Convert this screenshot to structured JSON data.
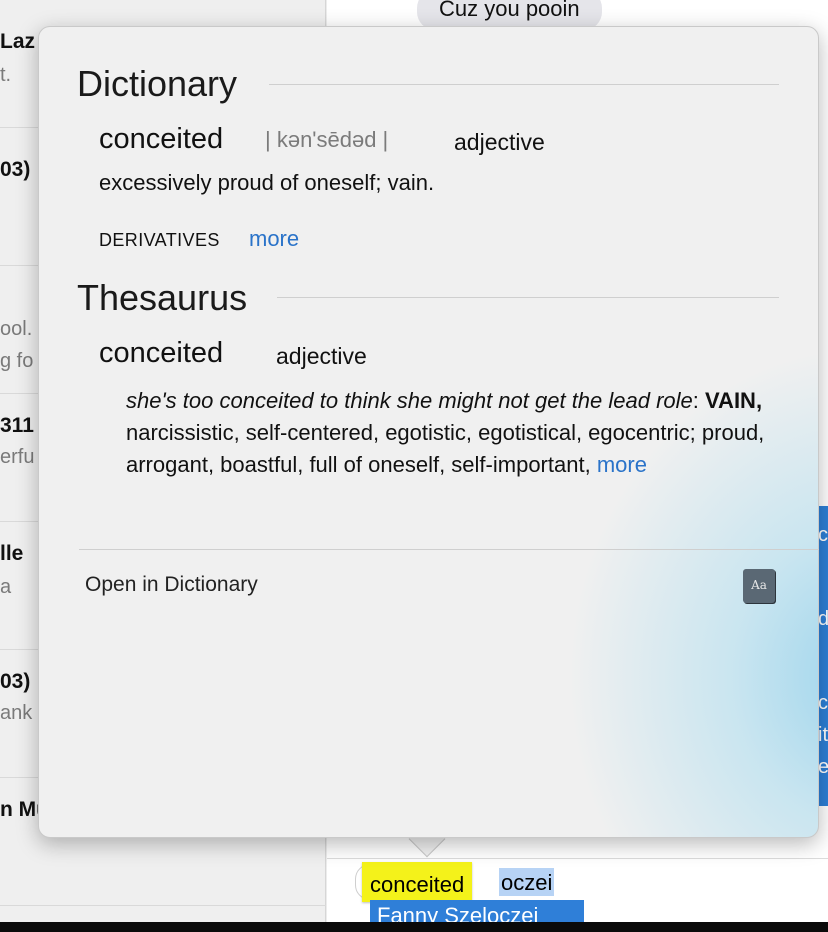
{
  "sidebar": {
    "items": [
      {
        "name": "Laz",
        "snippet": "t."
      },
      {
        "name": "03)",
        "snippet": ""
      },
      {
        "name": "",
        "snippet": "ool.",
        "snippet2": "g fo"
      },
      {
        "name": "311",
        "snippet": "erfu"
      },
      {
        "name": "lle",
        "snippet": "a"
      },
      {
        "name": "03)",
        "snippet": "ank"
      },
      {
        "name": "n Mu",
        "snippet": ""
      }
    ]
  },
  "chat": {
    "bubble_text": "Cuz you pooin",
    "right_strip_chars": [
      "c",
      "d",
      "c",
      "it",
      "e"
    ]
  },
  "compose": {
    "highlighted_word": "conceited",
    "typed_rest": "oczei",
    "suggestion": "Fanny Szeloczei"
  },
  "dictionary": {
    "section_title": "Dictionary",
    "headword": "conceited",
    "pronunciation": "| kən'sēdəd |",
    "part_of_speech": "adjective",
    "definition": "excessively proud of oneself; vain.",
    "derivatives_label": "DERIVATIVES",
    "more_link": "more"
  },
  "thesaurus": {
    "section_title": "Thesaurus",
    "headword": "conceited",
    "part_of_speech": "adjective",
    "example": "she's too conceited to think she might not get the lead role",
    "separator": ": ",
    "main_synonym": "VAIN,",
    "synonyms": " narcissistic, self-centered, egotistic, egotistical, egocentric; proud, arrogant, boastful, full of oneself, self-important, ",
    "more_link": "more"
  },
  "footer": {
    "open_label": "Open in Dictionary",
    "book_icon_text": "Aa"
  },
  "colors": {
    "link": "#2a73c9",
    "highlight": "#f4f21a",
    "suggestion_bg": "#2f7fd8"
  }
}
